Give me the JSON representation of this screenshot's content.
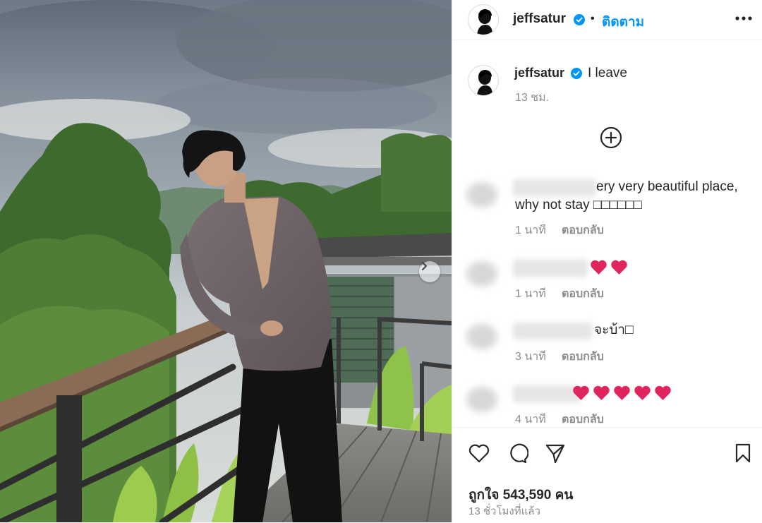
{
  "post": {
    "photo_alt": "",
    "author": {
      "username": "jeffsatur",
      "verified": true,
      "follow_label": "ติดตาม",
      "separator": "•"
    },
    "caption": {
      "username": "jeffsatur",
      "text": "I leave",
      "time": "13 ชม."
    },
    "comments": [
      {
        "text": "ery very beautiful place, why not stay □□□□□□",
        "time": "1 นาที",
        "reply_label": "ตอบกลับ",
        "hearts": 0
      },
      {
        "text": "",
        "time": "1 นาที",
        "reply_label": "ตอบกลับ",
        "hearts": 2
      },
      {
        "text": "จะบ้า□",
        "time": "3 นาที",
        "reply_label": "ตอบกลับ",
        "hearts": 0
      },
      {
        "text": "",
        "time": "4 นาที",
        "reply_label": "ตอบกลับ",
        "hearts": 5
      }
    ],
    "likes_text": "ถูกใจ 543,590 คน",
    "posted_ago": "13 ชั่วโมงที่แล้ว"
  },
  "icons": {
    "more": "more-horizontal-icon",
    "load_more": "plus-circle-icon",
    "like": "heart-outline-icon",
    "comment": "comment-bubble-icon",
    "share": "paper-plane-icon",
    "save": "bookmark-icon",
    "next": "chevron-right-icon"
  },
  "colors": {
    "accent": "#0095f6",
    "heart_red": "#e0245e",
    "muted": "#8e8e8e",
    "text": "#262626"
  }
}
